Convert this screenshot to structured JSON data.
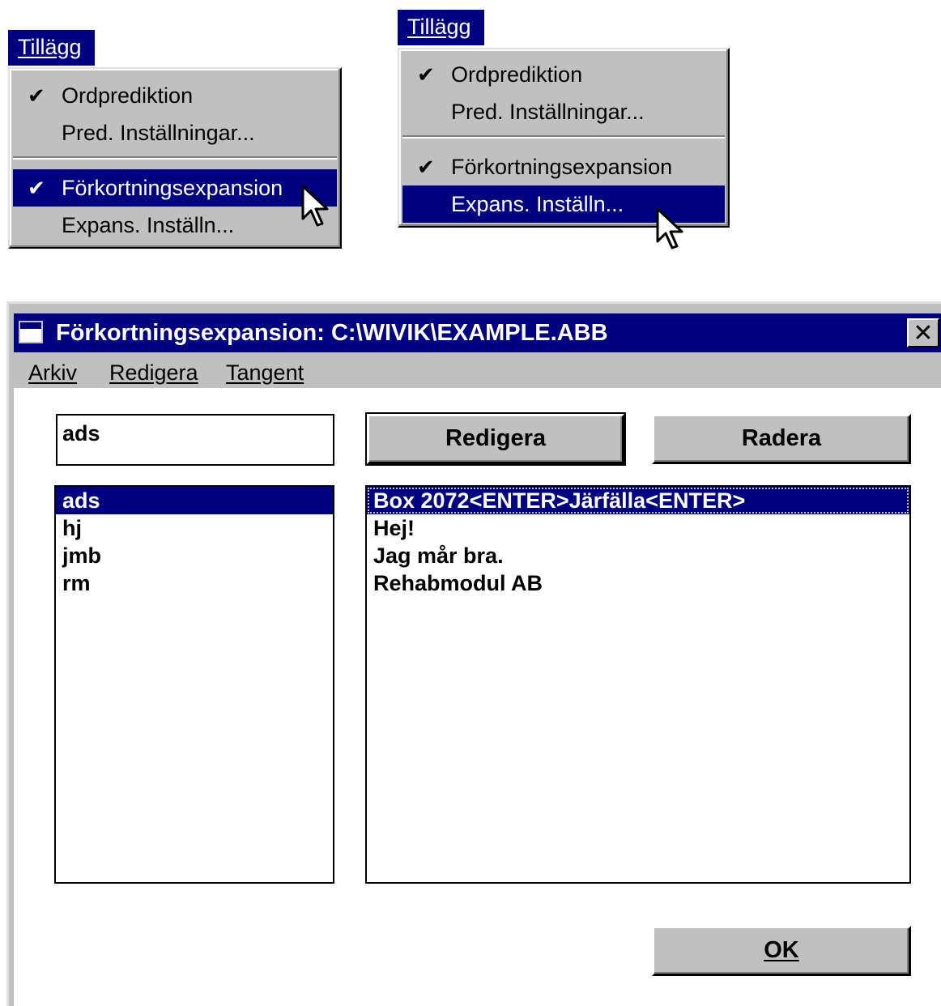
{
  "menu_left": {
    "header": "Tillägg",
    "items": [
      {
        "label": "Ordprediktion",
        "checked": true,
        "selected": false
      },
      {
        "label": "Pred. Inställningar...",
        "checked": false,
        "selected": false
      },
      {
        "label": "Förkortningsexpansion",
        "checked": true,
        "selected": true
      },
      {
        "label": "Expans. Inställn...",
        "checked": false,
        "selected": false
      }
    ]
  },
  "menu_right": {
    "header": "Tillägg",
    "items": [
      {
        "label": "Ordprediktion",
        "checked": true,
        "selected": false
      },
      {
        "label": "Pred. Inställningar...",
        "checked": false,
        "selected": false
      },
      {
        "label": "Förkortningsexpansion",
        "checked": true,
        "selected": false
      },
      {
        "label": "Expans. Inställn...",
        "checked": false,
        "selected": true
      }
    ]
  },
  "check_glyph": "✔",
  "dialog": {
    "title": "Förkortningsexpansion: C:\\WIVIK\\EXAMPLE.ABB",
    "close_glyph": "✕",
    "menubar": [
      "Arkiv",
      "Redigera",
      "Tangent"
    ],
    "input_value": "ads",
    "edit_button": "Redigera",
    "delete_button": "Radera",
    "ok_button": "OK",
    "abbreviations": [
      "ads",
      "hj",
      "jmb",
      "rm"
    ],
    "selected_abbreviation": "ads",
    "expansions": [
      "Box 2072<ENTER>Järfälla<ENTER>",
      "Hej!",
      "Jag mår bra.",
      "Rehabmodul AB"
    ],
    "selected_expansion": "Box 2072<ENTER>Järfälla<ENTER>"
  },
  "colors": {
    "highlight": "#000080",
    "face": "#c0c0c0",
    "window": "#ffffff"
  }
}
